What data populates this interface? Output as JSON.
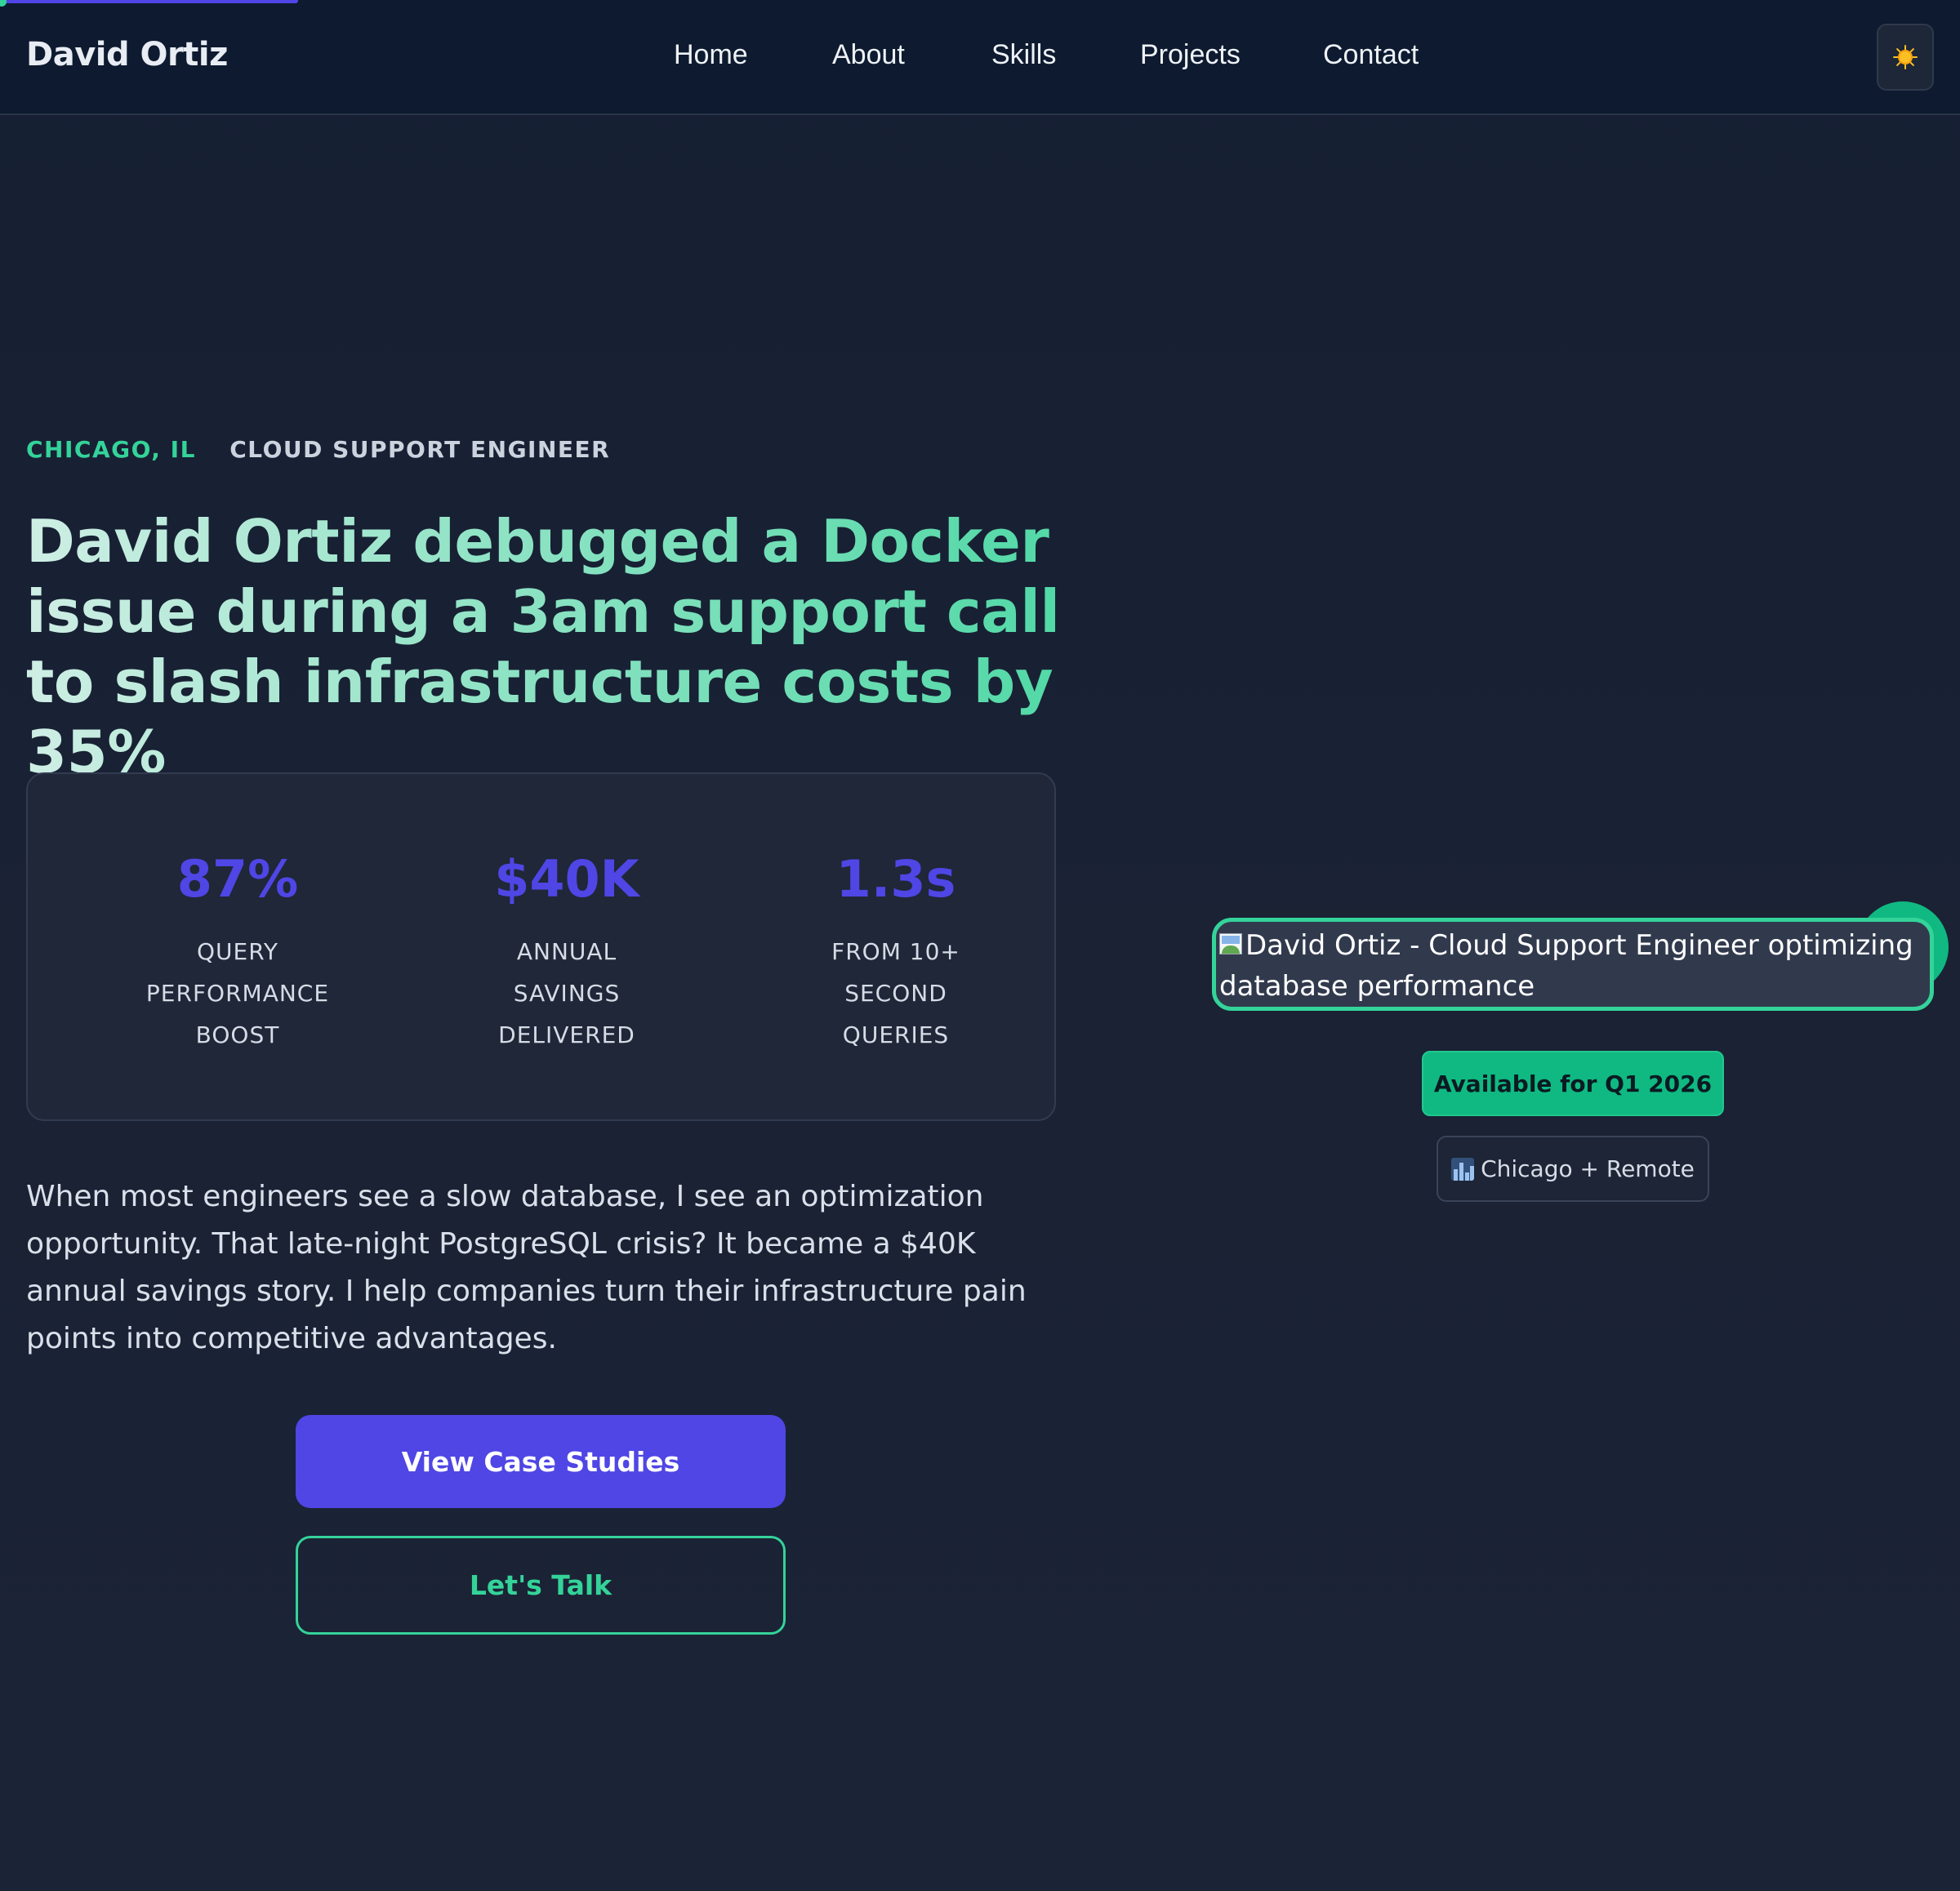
{
  "nav": {
    "brand": "David Ortiz",
    "links": [
      "Home",
      "About",
      "Skills",
      "Projects",
      "Contact"
    ],
    "theme_toggle_icon": "sun-icon"
  },
  "hero": {
    "location": "CHICAGO, IL",
    "role": "CLOUD SUPPORT ENGINEER",
    "headline": "David Ortiz debugged a Docker issue during a 3am support call to slash infrastructure costs by 35%",
    "stats": [
      {
        "value": "87%",
        "label": "QUERY PERFORMANCE BOOST"
      },
      {
        "value": "$40K",
        "label": "ANNUAL SAVINGS DELIVERED"
      },
      {
        "value": "1.3s",
        "label": "FROM 10+ SECOND QUERIES"
      }
    ],
    "intro": "When most engineers see a slow database, I see an optimization opportunity. That late-night PostgreSQL crisis? It became a $40K annual savings story. I help companies turn their infrastructure pain points into competitive advantages.",
    "primary_cta": "View Case Studies",
    "secondary_cta": "Let's Talk"
  },
  "profile": {
    "image_alt": "David Ortiz - Cloud Support Engineer optimizing database performance",
    "availability": "Available for Q1 2026",
    "location_badge": "Chicago + Remote",
    "location_badge_icon": "cityscape-icon"
  },
  "colors": {
    "accent_indigo": "#4f46e5",
    "accent_green": "#34d399",
    "badge_green": "#10b981",
    "background": "#172032",
    "nav_background": "#0d1a2f"
  }
}
